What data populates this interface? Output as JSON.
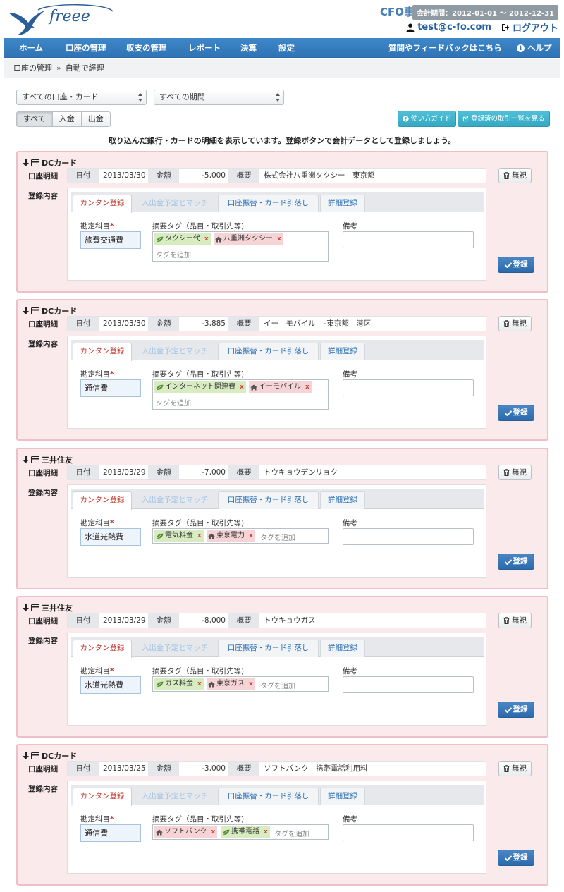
{
  "brand": {
    "logo_text": "freee"
  },
  "header": {
    "company": "CFO事務所",
    "period": "会計期間：2012-01-01 ～ 2012-12-31",
    "user_email": "test@c-fo.com",
    "logout": "ログアウト"
  },
  "nav": {
    "items": [
      "ホーム",
      "口座の管理",
      "収支の管理",
      "レポート",
      "決算",
      "設定"
    ],
    "feedback": "質問やフィードバックはこちら",
    "help": "ヘルプ"
  },
  "breadcrumb": {
    "parent": "口座の管理",
    "separator": "»",
    "current": "自動で経理"
  },
  "filters": {
    "account_select": "すべての口座・カード",
    "period_select": "すべての期間",
    "segments": [
      "すべて",
      "入金",
      "出金"
    ],
    "guide_button": "使い方ガイド",
    "registered_button": "登録済の取引一覧を見る"
  },
  "intro": "取り込んだ銀行・カードの明細を表示しています。登録ボタンで会計データとして登録しましょう。",
  "labels": {
    "statement": "口座明細",
    "content": "登録内容",
    "date": "日付",
    "amount": "金額",
    "summary": "概要",
    "ignore": "無視",
    "tabs": [
      "カンタン登録",
      "入出金予定とマッチ",
      "口座振替・カード引落し",
      "詳細登録"
    ],
    "account_item": "勘定科目",
    "required_mark": "*",
    "tags_label": "摘要タグ（品目・取引先等)",
    "note_label": "備考",
    "add_tag": "タグを追加",
    "register": "登録"
  },
  "entries": [
    {
      "account": "DCカード",
      "date": "2013/03/30",
      "amount": "-5,000",
      "summary": "株式会社八重洲タクシー　東京都",
      "account_item": "旅費交通費",
      "tags": [
        {
          "text": "タクシー代",
          "kind": "item"
        },
        {
          "text": "八重洲タクシー",
          "kind": "partner"
        }
      ]
    },
    {
      "account": "DCカード",
      "date": "2013/03/30",
      "amount": "-3,885",
      "summary": "イー　モバイル　–東京都　港区",
      "account_item": "通信費",
      "tags": [
        {
          "text": "インターネット関連費",
          "kind": "item"
        },
        {
          "text": "イーモバイル",
          "kind": "partner"
        }
      ]
    },
    {
      "account": "三井住友",
      "date": "2013/03/29",
      "amount": "-7,000",
      "summary": "トウキョウデンリョク",
      "account_item": "水道光熱費",
      "tags": [
        {
          "text": "電気料金",
          "kind": "item"
        },
        {
          "text": "東京電力",
          "kind": "partner"
        }
      ]
    },
    {
      "account": "三井住友",
      "date": "2013/03/29",
      "amount": "-8,000",
      "summary": "トウキョウガス",
      "account_item": "水道光熱費",
      "tags": [
        {
          "text": "ガス料金",
          "kind": "item"
        },
        {
          "text": "東京ガス",
          "kind": "partner"
        }
      ]
    },
    {
      "account": "DCカード",
      "date": "2013/03/25",
      "amount": "-3,000",
      "summary": "ソフトバンク　携帯電話利用料",
      "account_item": "通信費",
      "tags": [
        {
          "text": "ソフトバンク",
          "kind": "partner"
        },
        {
          "text": "携帯電話",
          "kind": "item"
        }
      ]
    }
  ],
  "colors": {
    "nav_bg": "#2f74b4",
    "card_bg": "#fbeaec",
    "card_border": "#eebfc6",
    "item_tag": "#d8ecc1",
    "partner_tag": "#f6d4d6",
    "primary_button": "#2c6aab",
    "info_button": "#35a8c3",
    "active_tab_text": "#c0392b"
  },
  "icons": {
    "logo": "swallow-bird-icon",
    "user": "user-icon",
    "logout": "logout-arrow-icon",
    "help": "info-icon",
    "card_collapse": "arrow-down-icon",
    "card_type": "credit-card-icon",
    "ignore": "trash-icon",
    "register": "check-icon",
    "item_tag": "leaf-icon",
    "partner_tag": "house-icon"
  }
}
